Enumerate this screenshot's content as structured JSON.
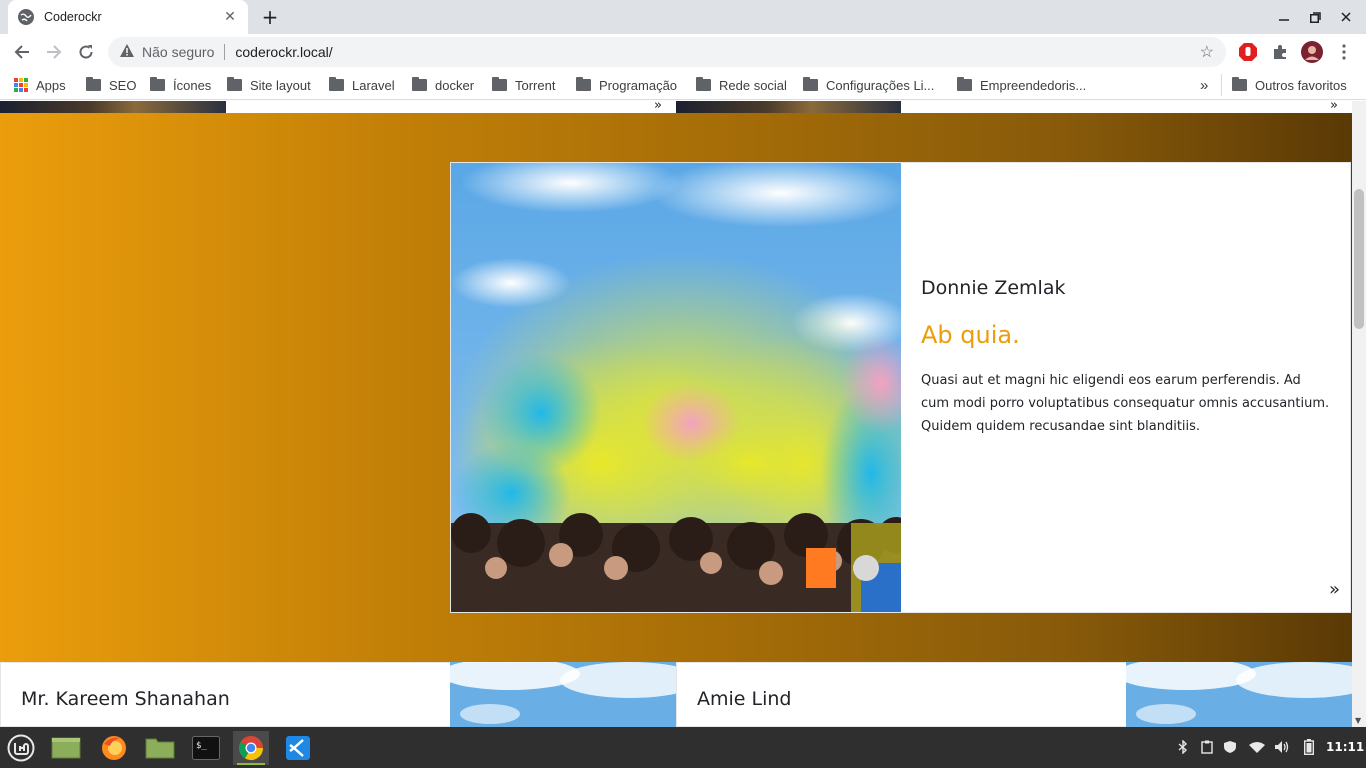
{
  "browser": {
    "tab": {
      "title": "Coderockr"
    },
    "omnibox": {
      "security_label": "Não seguro",
      "url": "coderockr.local/"
    },
    "bookmarks": [
      {
        "label": "Apps",
        "type": "apps"
      },
      {
        "label": "SEO",
        "type": "folder"
      },
      {
        "label": "Ícones",
        "type": "folder"
      },
      {
        "label": "Site layout",
        "type": "folder"
      },
      {
        "label": "Laravel",
        "type": "folder"
      },
      {
        "label": "docker",
        "type": "folder"
      },
      {
        "label": "Torrent",
        "type": "folder"
      },
      {
        "label": "Programação",
        "type": "folder"
      },
      {
        "label": "Rede social",
        "type": "folder"
      },
      {
        "label": "Configurações Li...",
        "type": "folder"
      },
      {
        "label": "Empreendedoris...",
        "type": "folder"
      }
    ],
    "bookmarks_overflow": "»",
    "other_bookmarks": "Outros favoritos"
  },
  "page": {
    "featured": {
      "author": "Donnie Zemlak",
      "title": "Ab quia.",
      "body": "Quasi aut et magni hic eligendi eos earum perferendis. Ad cum modi porro voluptatibus consequatur omnis accusantium. Quidem quidem recusandae sint blanditiis.",
      "next_glyph": "»"
    },
    "cards": [
      {
        "author": "Mr. Kareem Shanahan"
      },
      {
        "author": "Amie Lind"
      }
    ],
    "strip_chevron": "»",
    "accent_color": "#eb9d0c"
  },
  "taskbar": {
    "clock": "11:11"
  }
}
